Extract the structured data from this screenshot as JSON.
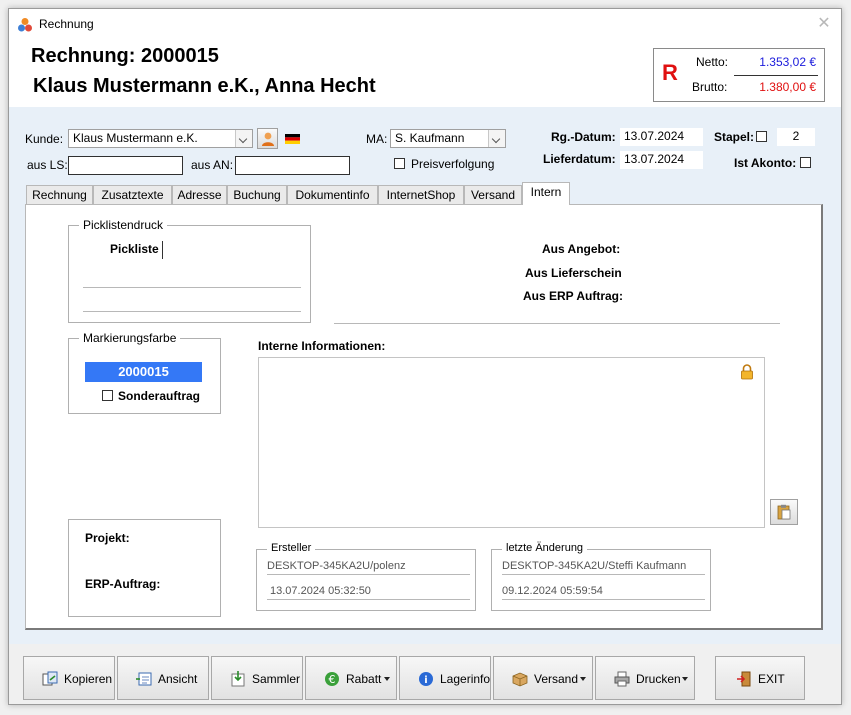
{
  "window": {
    "title": "Rechnung"
  },
  "header": {
    "doc_title": "Rechnung: 2000015",
    "customer_title": "Klaus Mustermann e.K., Anna Hecht",
    "totals": {
      "badge": "R",
      "netto_label": "Netto:",
      "netto_value": "1.353,02 €",
      "brutto_label": "Brutto:",
      "brutto_value": "1.380,00 €"
    }
  },
  "form": {
    "kunde_label": "Kunde:",
    "kunde_value": "Klaus Mustermann e.K.",
    "ma_label": "MA:",
    "ma_value": "S. Kaufmann",
    "rg_datum_label": "Rg.-Datum:",
    "rg_datum_value": "13.07.2024",
    "stapel_label": "Stapel:",
    "stapel_value": "2",
    "aus_ls_label": "aus LS:",
    "aus_ls_value": "",
    "aus_an_label": "aus AN:",
    "aus_an_value": "",
    "preisverfolgung_label": "Preisverfolgung",
    "lieferdatum_label": "Lieferdatum:",
    "lieferdatum_value": "13.07.2024",
    "akonto_label": "Ist Akonto:"
  },
  "tabs": [
    {
      "label": "Rechnung"
    },
    {
      "label": "Zusatztexte"
    },
    {
      "label": "Adresse"
    },
    {
      "label": "Buchung"
    },
    {
      "label": "Dokumentinfo"
    },
    {
      "label": "InternetShop"
    },
    {
      "label": "Versand"
    },
    {
      "label": "Intern"
    }
  ],
  "intern": {
    "picklist_group_title": "Picklistendruck",
    "pickliste_label": "Pickliste",
    "pickliste_value": "",
    "mark_group_title": "Markierungsfarbe",
    "mark_value": "2000015",
    "sonderauftrag_label": "Sonderauftrag",
    "aus_angebot_label": "Aus Angebot:",
    "aus_angebot_value": "",
    "aus_lieferschein_label": "Aus Lieferschein:",
    "aus_lieferschein_value": "",
    "aus_erp_label": "Aus ERP Auftrag:",
    "aus_erp_value": "",
    "interne_info_label": "Interne Informationen:",
    "interne_info_value": "",
    "projekt_label": "Projekt:",
    "projekt_value": "",
    "erp_auftrag_label": "ERP-Auftrag:",
    "erp_auftrag_value": "",
    "ersteller_title": "Ersteller",
    "ersteller_user": "DESKTOP-345KA2U/polenz",
    "ersteller_date": "13.07.2024 05:32:50",
    "aenderung_title": "letzte Änderung",
    "aenderung_user": "DESKTOP-345KA2U/Steffi Kaufmann",
    "aenderung_date": "09.12.2024 05:59:54"
  },
  "footer": {
    "kopieren": "Kopieren",
    "ansicht": "Ansicht",
    "sammler": "Sammler",
    "rabatt": "Rabatt",
    "lagerinfo": "Lagerinfo",
    "versand": "Versand",
    "drucken": "Drucken",
    "exit": "EXIT"
  },
  "colors": {
    "accent_blue": "#3478f6",
    "netto": "#1a1adc",
    "brutto": "#e01010",
    "form_bg": "#e8f0f8"
  }
}
